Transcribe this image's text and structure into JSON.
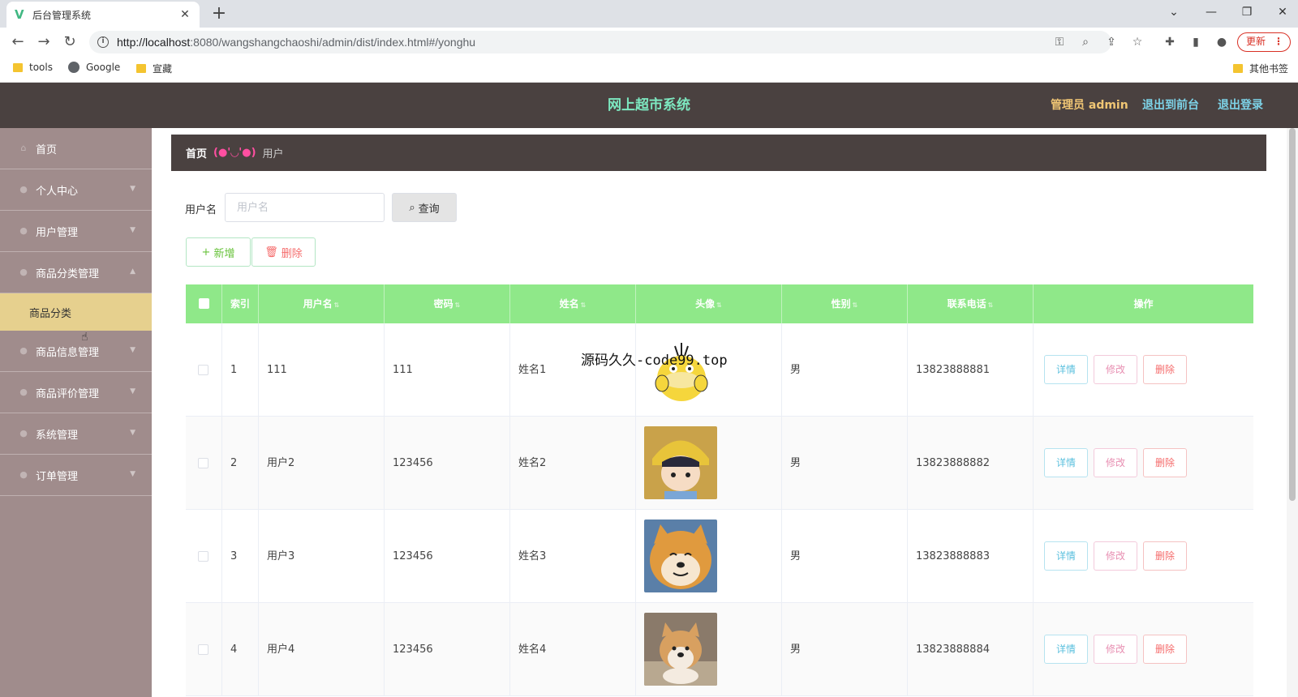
{
  "browser": {
    "tab_title": "后台管理系统",
    "url_host": "http://localhost",
    "url_path": ":8080/wangshangchaoshi/admin/dist/index.html#/yonghu",
    "update_label": "更新",
    "bookmarks": [
      "tools",
      "Google",
      "宣藏"
    ],
    "other_bookmarks": "其他书签"
  },
  "header": {
    "title": "网上超市系统",
    "admin_label": "管理员 admin",
    "to_front": "退出到前台",
    "logout": "退出登录",
    "colors": {
      "bar": "#4a4140",
      "title": "#7de8c0",
      "admin": "#f0c674",
      "links": "#7dd3e8"
    }
  },
  "sidebar": {
    "items": [
      {
        "label": "首页",
        "icon": "home-icon"
      },
      {
        "label": "个人中心",
        "icon": "user-icon"
      },
      {
        "label": "用户管理",
        "icon": "users-icon"
      },
      {
        "label": "商品分类管理",
        "icon": "category-icon"
      },
      {
        "label": "商品信息管理",
        "icon": "goods-icon"
      },
      {
        "label": "商品评价管理",
        "icon": "comment-icon"
      },
      {
        "label": "系统管理",
        "icon": "settings-icon"
      },
      {
        "label": "订单管理",
        "icon": "order-icon"
      }
    ],
    "sub_item": "商品分类"
  },
  "breadcrumb": {
    "home": "首页",
    "separator": "(●'◡'●)",
    "current": "用户"
  },
  "search": {
    "label": "用户名",
    "placeholder": "用户名",
    "query_label": "查询"
  },
  "actions": {
    "add_label": "新增",
    "delete_label": "删除"
  },
  "table": {
    "columns": [
      "索引",
      "用户名",
      "密码",
      "姓名",
      "头像",
      "性别",
      "联系电话",
      "操作"
    ],
    "rows": [
      {
        "index": "1",
        "username": "111",
        "password": "111",
        "name": "姓名1",
        "avatar": "duck-avatar",
        "gender": "男",
        "phone": "13823888881"
      },
      {
        "index": "2",
        "username": "用户2",
        "password": "123456",
        "name": "姓名2",
        "avatar": "boy-avatar",
        "gender": "男",
        "phone": "13823888882"
      },
      {
        "index": "3",
        "username": "用户3",
        "password": "123456",
        "name": "姓名3",
        "avatar": "shiba-avatar",
        "gender": "男",
        "phone": "13823888883"
      },
      {
        "index": "4",
        "username": "用户4",
        "password": "123456",
        "name": "姓名4",
        "avatar": "puppy-avatar",
        "gender": "男",
        "phone": "13823888884"
      }
    ],
    "op_detail": "详情",
    "op_edit": "修改",
    "op_delete": "删除",
    "header_color": "#8fe889"
  },
  "overlay_text": "源码久久-code99.top"
}
